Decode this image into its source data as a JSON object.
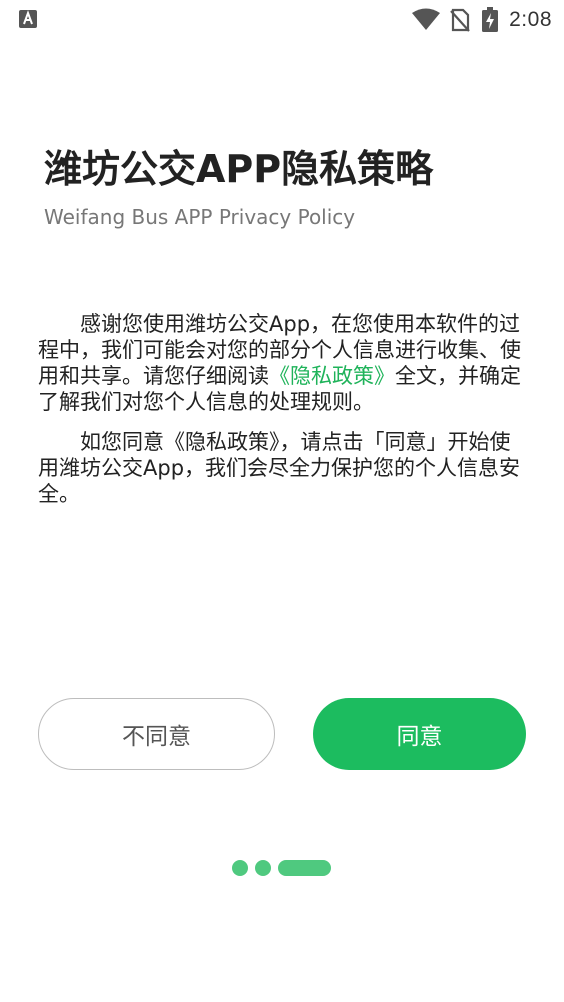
{
  "status_bar": {
    "time": "2:08",
    "left_icon": "app-notification-icon",
    "icons": [
      "wifi-icon",
      "no-sim-icon",
      "battery-charging-icon"
    ]
  },
  "header": {
    "title": "潍坊公交APP隐私策略",
    "subtitle": "Weifang Bus APP Privacy Policy"
  },
  "content": {
    "para1_before": "感谢您使用潍坊公交App，在您使用本软件的过程中，我们可能会对您的部分个人信息进行收集、使用和共享。请您仔细阅读",
    "policy_link": "《隐私政策》",
    "para1_after": "全文，并确定了解我们对您个人信息的处理规则。",
    "para2": "如您同意《隐私政策》，请点击「同意」开始使用潍坊公交App，我们会尽全力保护您的个人信息安全。"
  },
  "buttons": {
    "disagree_label": "不同意",
    "agree_label": "同意"
  },
  "page_indicator": {
    "total": 3,
    "active_index": 2
  },
  "colors": {
    "accent": "#1cbc5f",
    "link": "#1fb35a",
    "indicator": "#4fc97f"
  }
}
